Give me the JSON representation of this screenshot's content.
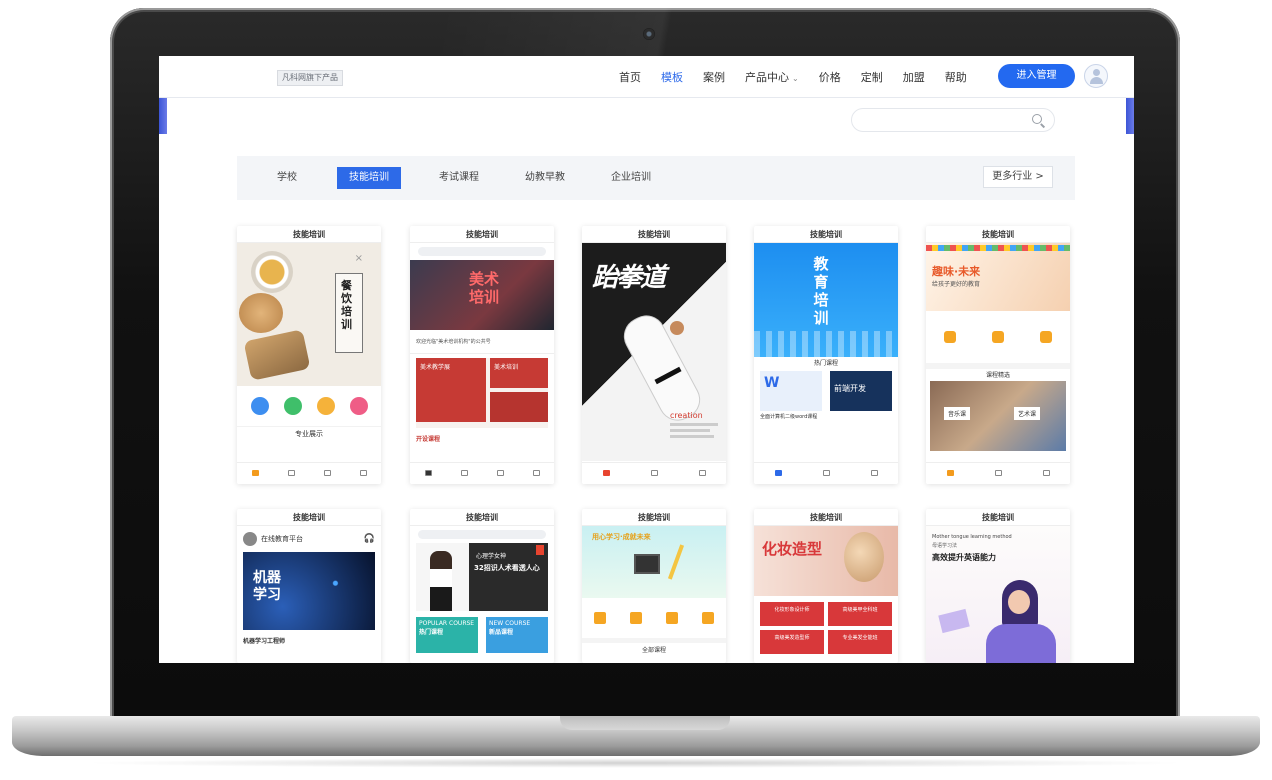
{
  "site": {
    "logo": "凡科网旗下产品",
    "nav": [
      "首页",
      "模板",
      "案例",
      "产品中心",
      "价格",
      "定制",
      "加盟",
      "帮助"
    ],
    "nav_active": "模板",
    "enter_button": "进入管理"
  },
  "categories": {
    "items": [
      "学校",
      "技能培训",
      "考试课程",
      "幼教早教",
      "企业培训"
    ],
    "active": "技能培训",
    "more": "更多行业 >"
  },
  "cards": [
    {
      "title": "技能培训",
      "texts": {
        "brush": "餐饮培训",
        "sub": "专业展示"
      }
    },
    {
      "title": "技能培训",
      "texts": {
        "headline": "美术培训",
        "notice": "欢迎光临\"美术培训机构\"的公共号",
        "block1": "美术教学展",
        "block2": "美术培训",
        "footer": "开设课程"
      }
    },
    {
      "title": "技能培训",
      "texts": {
        "headline": "跆拳道",
        "brand": "creation"
      }
    },
    {
      "title": "技能培训",
      "texts": {
        "headline": "教育培训",
        "section": "热门课程",
        "item1": "全面计算机二级word课程",
        "item2": "前端开发"
      }
    },
    {
      "title": "技能培训",
      "texts": {
        "headline": "趣味·未来",
        "sub": "给孩子更好的教育",
        "section": "课程精选",
        "c1": "音乐课",
        "c2": "艺术课"
      }
    },
    {
      "title": "技能培训",
      "texts": {
        "platform": "在线教育平台",
        "banner": "机器学习",
        "caption": "机器学习工程师"
      }
    },
    {
      "title": "技能培训",
      "texts": {
        "teacher": "心理学女神",
        "slogan": "32招识人术看透人心",
        "p1": "POPULAR COURSE",
        "p1b": "热门课程",
        "p2": "NEW COURSE",
        "p2b": "新品课程"
      }
    },
    {
      "title": "技能培训",
      "texts": {
        "headline": "用心学习·成就未来",
        "section": "全部课程"
      }
    },
    {
      "title": "技能培训",
      "texts": {
        "headline": "化妆造型",
        "b1": "化妆形象设计师",
        "b2": "高级美甲全科班",
        "b3": "高级美发造型师",
        "b4": "专业美发全能班"
      }
    },
    {
      "title": "技能培训",
      "texts": {
        "en": "Mother tongue learning method",
        "sub": "母语学习法",
        "headline": "高效提升英语能力"
      }
    }
  ],
  "colors": {
    "accent": "#2369f0",
    "bezel": "#111111",
    "category_bg": "#f3f5f8"
  }
}
